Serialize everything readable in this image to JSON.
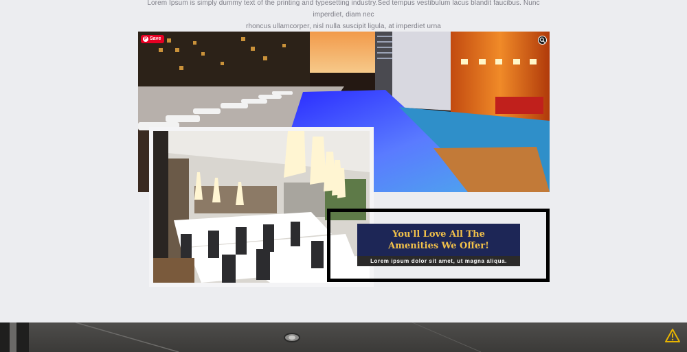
{
  "intro": {
    "line1": "Lorem Ipsum is simply dummy text of the printing and typesetting industry.Sed tempus vestibulum lacus blandit faucibus. Nunc imperdiet, diam nec",
    "line2": "rhoncus ullamcorper, nisl nulla suscipit ligula, at imperdiet urna"
  },
  "pin_save": {
    "label": "Save",
    "icon": "pinterest-icon",
    "color": "#e60023"
  },
  "visual_search": {
    "icon": "lens-icon"
  },
  "amenities": {
    "title": "You'll Love All The Amenities We Offer!",
    "subtitle": "Lorem ipsum dolor sit amet, ut magna aliqua.",
    "title_color": "#f3c24a",
    "box_color": "#1d2656"
  },
  "scroll_top": {
    "icon": "warning-triangle-icon",
    "color": "#e8b400"
  }
}
